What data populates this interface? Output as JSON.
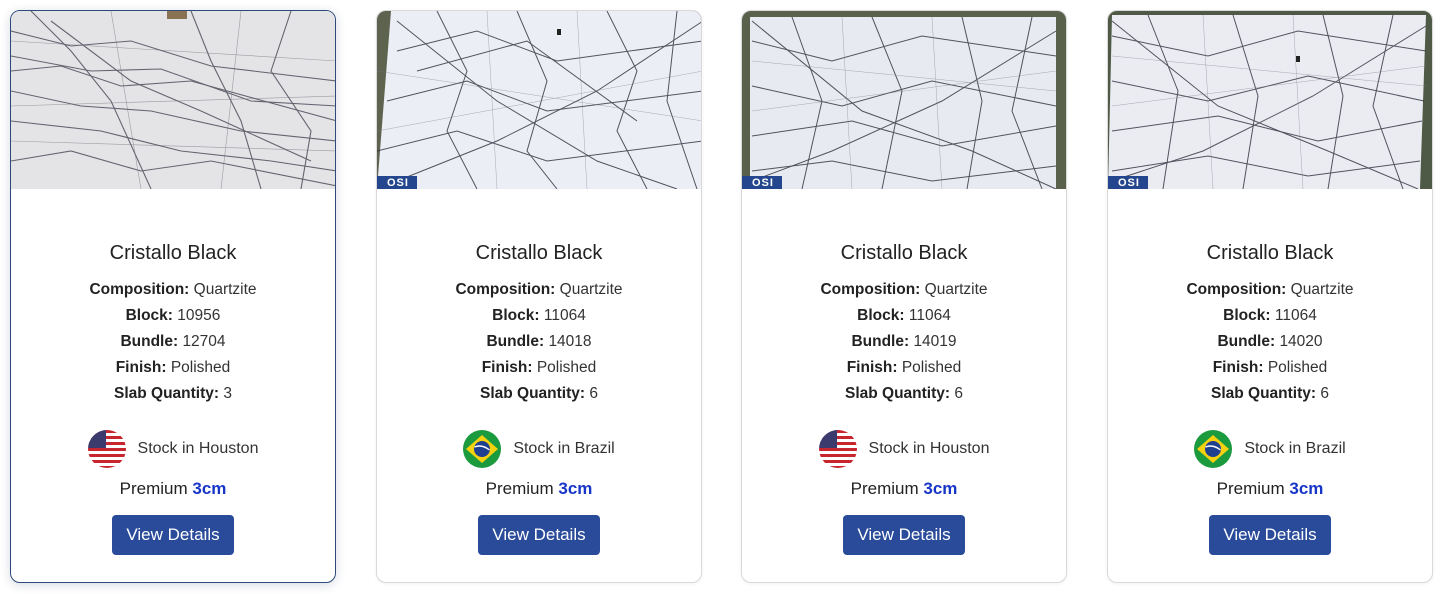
{
  "cards": [
    {
      "title": "Cristallo Black",
      "composition_label": "Composition:",
      "composition": "Quartzite",
      "block_label": "Block:",
      "block": "10956",
      "bundle_label": "Bundle:",
      "bundle": "12704",
      "finish_label": "Finish:",
      "finish": "Polished",
      "qty_label": "Slab Quantity:",
      "qty": "3",
      "flag_icon": "us-flag-icon",
      "stock": "Stock in Houston",
      "grade": "Premium",
      "thickness": "3cm",
      "button": "View Details",
      "badge": ""
    },
    {
      "title": "Cristallo Black",
      "composition_label": "Composition:",
      "composition": "Quartzite",
      "block_label": "Block:",
      "block": "11064",
      "bundle_label": "Bundle:",
      "bundle": "14018",
      "finish_label": "Finish:",
      "finish": "Polished",
      "qty_label": "Slab Quantity:",
      "qty": "6",
      "flag_icon": "brazil-flag-icon",
      "stock": "Stock in Brazil",
      "grade": "Premium",
      "thickness": "3cm",
      "button": "View Details",
      "badge": "OSI"
    },
    {
      "title": "Cristallo Black",
      "composition_label": "Composition:",
      "composition": "Quartzite",
      "block_label": "Block:",
      "block": "11064",
      "bundle_label": "Bundle:",
      "bundle": "14019",
      "finish_label": "Finish:",
      "finish": "Polished",
      "qty_label": "Slab Quantity:",
      "qty": "6",
      "flag_icon": "us-flag-icon",
      "stock": "Stock in Houston",
      "grade": "Premium",
      "thickness": "3cm",
      "button": "View Details",
      "badge": "OSI"
    },
    {
      "title": "Cristallo Black",
      "composition_label": "Composition:",
      "composition": "Quartzite",
      "block_label": "Block:",
      "block": "11064",
      "bundle_label": "Bundle:",
      "bundle": "14020",
      "finish_label": "Finish:",
      "finish": "Polished",
      "qty_label": "Slab Quantity:",
      "qty": "6",
      "flag_icon": "brazil-flag-icon",
      "stock": "Stock in Brazil",
      "grade": "Premium",
      "thickness": "3cm",
      "button": "View Details",
      "badge": "OSI"
    }
  ],
  "colors": {
    "button_bg": "#2a4b9a",
    "thickness_text": "#1736c8",
    "badge_bg": "#23468e"
  }
}
